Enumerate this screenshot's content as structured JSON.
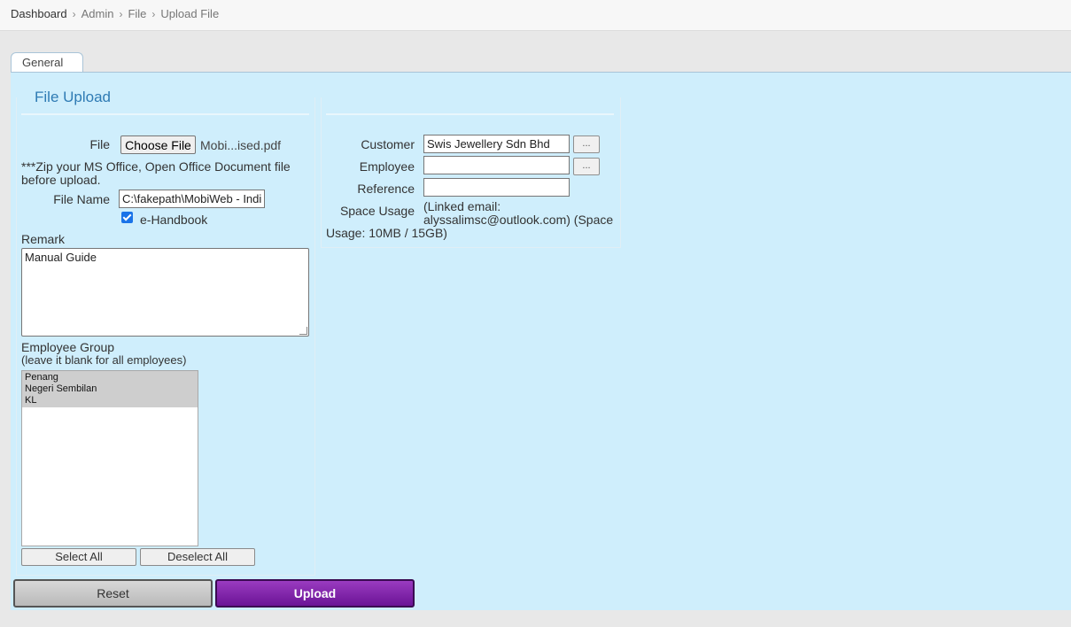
{
  "breadcrumb": [
    "Dashboard",
    "Admin",
    "File",
    "Upload File"
  ],
  "tabs": [
    {
      "label": "General"
    }
  ],
  "form": {
    "legend": "File Upload",
    "file_label": "File",
    "choose_file_label": "Choose File",
    "chosen_file": "Mobi...ised.pdf",
    "zip_note": "***Zip your MS Office, Open Office Document file before upload.",
    "file_name_label": "File Name",
    "file_name_value": "C:\\fakepath\\MobiWeb - Indi",
    "handbook_label": "e-Handbook",
    "handbook_checked": true,
    "remark_label": "Remark",
    "remark_value": "Manual Guide",
    "employee_group_label": "Employee Group",
    "employee_group_hint": "(leave it blank for all employees)",
    "employee_groups": [
      "Penang",
      "Negeri Sembilan",
      "KL"
    ],
    "select_all_label": "Select All",
    "deselect_all_label": "Deselect All"
  },
  "details": {
    "customer_label": "Customer",
    "customer_value": "Swis Jewellery Sdn Bhd",
    "employee_label": "Employee",
    "employee_value": "",
    "reference_label": "Reference",
    "reference_value": "",
    "lookup_label": "...",
    "space_usage_label": "Space Usage",
    "space_usage_text_1": "(Linked email:",
    "space_usage_text_2": "alyssalimsc@outlook.com) (Space",
    "space_usage_text_3": "Usage: 10MB / 15GB)"
  },
  "actions": {
    "reset_label": "Reset",
    "upload_label": "Upload"
  },
  "colors": {
    "panel_bg": "#cfeefc",
    "legend_blue": "#2f7bb4",
    "upload_purple": "#7b1fa2",
    "checkbox_blue": "#1a73e8"
  }
}
